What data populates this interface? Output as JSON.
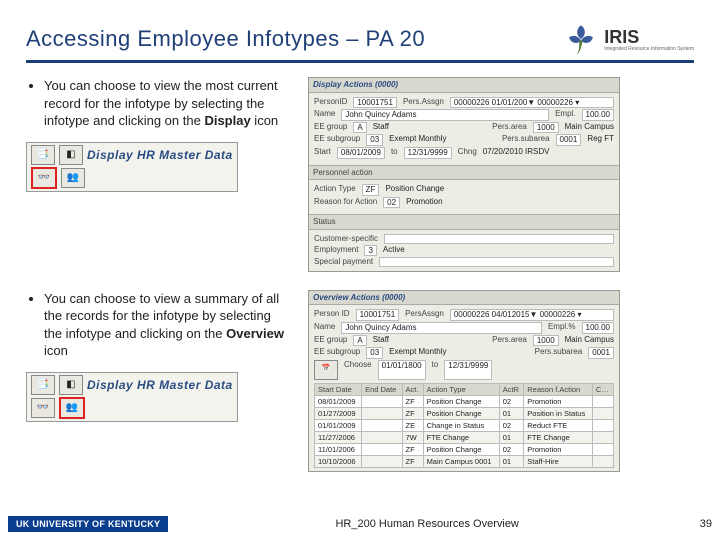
{
  "title": "Accessing Employee Infotypes – PA 20",
  "logo": {
    "name": "IRIS",
    "sub": "Integrated Resource Information System"
  },
  "section1": {
    "bullet_pre": "You can choose to view the most current record for the infotype by selecting the infotype and clicking on the ",
    "bullet_bold": "Display",
    "bullet_post": " icon",
    "toolbar_title": "Display HR Master Data",
    "panel_title": "Display Actions (0000)",
    "lines": {
      "person_id_lbl": "PersonID",
      "person_id": "10001751",
      "pers_assgn_lbl": "Pers.Assgn",
      "pers_assgn": "00000226 01/01/200▼ 00000226 ▾",
      "name_lbl": "Name",
      "name": "John Quincy Adams",
      "emp_lbl": "Empl.",
      "emp": "100.00",
      "ee_grp_lbl": "EE group",
      "ee_grp_code": "A",
      "ee_grp": "Staff",
      "pers_area_lbl": "Pers.area",
      "pers_area_code": "1000",
      "pers_area": "Main Campus",
      "ee_sub_lbl": "EE subgroup",
      "ee_sub_code": "03",
      "ee_sub": "Exempt Monthly",
      "pers_sub_lbl": "Pers.subarea",
      "pers_sub_code": "0001",
      "pers_sub": "Reg FT",
      "start_lbl": "Start",
      "start": "08/01/2009",
      "to_lbl": "to",
      "end": "12/31/9999",
      "chng_lbl": "Chng",
      "chng": "07/20/2010  IRSDV"
    },
    "pa_hdr": "Personnel action",
    "pa": {
      "action_type_lbl": "Action Type",
      "action_type_code": "ZF",
      "action_type": "Position Change",
      "reason_lbl": "Reason for Action",
      "reason_code": "02",
      "reason": "Promotion"
    },
    "status_hdr": "Status",
    "status": {
      "cust_lbl": "Customer-specific",
      "emp_lbl": "Employment",
      "emp_code": "3",
      "emp": "Active",
      "sp_lbl": "Special payment"
    }
  },
  "section2": {
    "bullet_pre": "You can choose to view a summary of all the records for the infotype by selecting the infotype and clicking on the ",
    "bullet_bold": "Overview",
    "bullet_post": " icon",
    "toolbar_title": "Display HR Master Data",
    "panel_title": "Overview Actions (0000)",
    "lines": {
      "person_id_lbl": "Person ID",
      "person_id": "10001751",
      "pers_assgn_lbl": "PersAssgn",
      "pers_assgn": "00000226 04/012015▼ 00000226 ▾",
      "name_lbl": "Name",
      "name": "John Quincy Adams",
      "emp_lbl": "Empl.%",
      "emp": "100.00",
      "ee_grp_lbl": "EE group",
      "ee_grp_code": "A",
      "ee_grp": "Staff",
      "pers_area_lbl": "Pers.area",
      "pers_area_code": "1000",
      "pers_area": "Main Campus",
      "ee_sub_lbl": "EE subgroup",
      "ee_sub_code": "03",
      "ee_sub": "Exempt Monthly",
      "pers_sub_lbl": "Pers.subarea",
      "pers_sub_code": "0001",
      "choose_lbl": "Choose",
      "choose_from": "01/01/1800",
      "to_lbl": "to",
      "choose_to": "12/31/9999"
    },
    "table": {
      "headers": [
        "Start Date",
        "End Date",
        "Act.",
        "Action Type",
        "ActR",
        "Reason f.Action",
        "C…"
      ],
      "rows": [
        [
          "08/01/2009",
          "",
          "ZF",
          "Position Change",
          "02",
          "Promotion",
          ""
        ],
        [
          "01/27/2009",
          "",
          "ZF",
          "Position Change",
          "01",
          "Position in Status",
          ""
        ],
        [
          "01/01/2009",
          "",
          "ZE",
          "Change in Status",
          "02",
          "Reduct FTE",
          ""
        ],
        [
          "11/27/2006",
          "",
          "7W",
          "FTE Change",
          "01",
          "FTE Change",
          ""
        ],
        [
          "11/01/2006",
          "",
          "ZF",
          "Position Change",
          "02",
          "Promotion",
          ""
        ],
        [
          "10/10/2006",
          "",
          "ZF",
          "Main Campus 0001",
          "01",
          "Staff-Hire",
          ""
        ]
      ]
    }
  },
  "footer": {
    "uk": "UK  UNIVERSITY OF KENTUCKY",
    "center": "HR_200 Human Resources Overview",
    "page": "39"
  }
}
